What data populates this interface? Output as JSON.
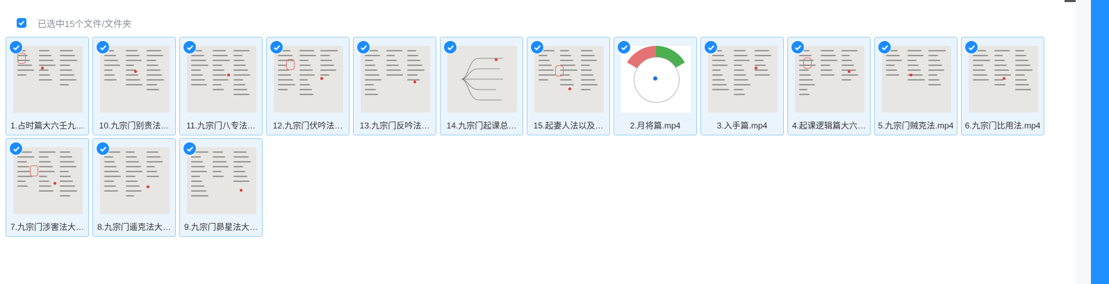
{
  "toolbar": {
    "label": "已选中15个文件/文件夹",
    "checked": true
  },
  "items": [
    {
      "name": "1.占时篇大六壬九…",
      "kind": "doc"
    },
    {
      "name": "10.九宗门别责法…",
      "kind": "doc"
    },
    {
      "name": "11.九宗门八专法…",
      "kind": "doc"
    },
    {
      "name": "12.九宗门伏吟法…",
      "kind": "doc"
    },
    {
      "name": "13.九宗门反吟法…",
      "kind": "doc"
    },
    {
      "name": "14.九宗门起课总…",
      "kind": "mindmap"
    },
    {
      "name": "15.起妻人法以及…",
      "kind": "doc"
    },
    {
      "name": "2.月将篇.mp4",
      "kind": "wheel"
    },
    {
      "name": "3.入手篇.mp4",
      "kind": "doc"
    },
    {
      "name": "4.起课逻辑篇大六…",
      "kind": "doc"
    },
    {
      "name": "5.九宗门贼克法.mp4",
      "kind": "doc"
    },
    {
      "name": "6.九宗门比用法.mp4",
      "kind": "doc"
    },
    {
      "name": "7.九宗门涉害法大…",
      "kind": "doc"
    },
    {
      "name": "8.九宗门遥克法大…",
      "kind": "doc"
    },
    {
      "name": "9.九宗门昴星法大…",
      "kind": "doc"
    }
  ],
  "colors": {
    "accent": "#1a8cff",
    "card_bg": "#eaf4fd",
    "card_border": "#9dd0f3",
    "right_bar": "#1e90ff"
  },
  "icons": {
    "selected": "check-icon"
  }
}
